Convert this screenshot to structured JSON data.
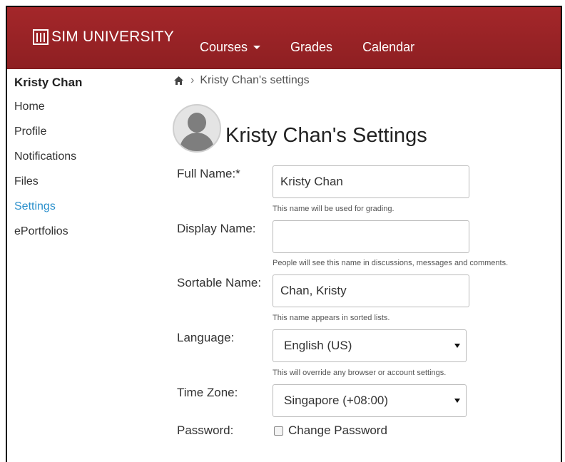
{
  "brand": {
    "logo_text": "SIM UNIVERSITY"
  },
  "nav": {
    "items": [
      {
        "label": "Courses"
      },
      {
        "label": "Grades"
      },
      {
        "label": "Calendar"
      }
    ]
  },
  "sidebar": {
    "user": "Kristy Chan",
    "items": [
      {
        "label": "Home"
      },
      {
        "label": "Profile"
      },
      {
        "label": "Notifications"
      },
      {
        "label": "Files"
      },
      {
        "label": "Settings",
        "active": true
      },
      {
        "label": "ePortfolios"
      }
    ]
  },
  "breadcrumb": {
    "current": "Kristy Chan's settings"
  },
  "page": {
    "title": "Kristy Chan's Settings"
  },
  "form": {
    "full_name": {
      "label": "Full Name:*",
      "value": "Kristy Chan",
      "hint": "This name will be used for grading."
    },
    "display_name": {
      "label": "Display Name:",
      "value": "",
      "hint": "People will see this name in discussions, messages and comments."
    },
    "sortable_name": {
      "label": "Sortable Name:",
      "value": "Chan, Kristy",
      "hint": "This name appears in sorted lists."
    },
    "language": {
      "label": "Language:",
      "value": "English (US)",
      "hint": "This will override any browser or account settings."
    },
    "time_zone": {
      "label": "Time Zone:",
      "value": "Singapore (+08:00)"
    },
    "password": {
      "label": "Password:",
      "checkbox_label": "Change Password",
      "checked": false
    }
  },
  "colors": {
    "header": "#9e2528",
    "active_link": "#2b90cc"
  }
}
